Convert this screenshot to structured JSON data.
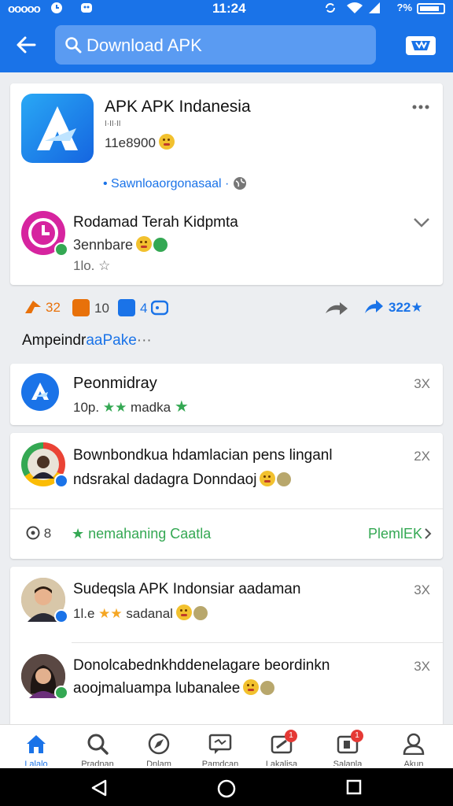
{
  "status_bar": {
    "dots": "ooooo",
    "time": "11:24",
    "battery_pct": "?%"
  },
  "search": {
    "placeholder": "Download APK"
  },
  "featured": {
    "app_title": "APK APK Indanesia",
    "app_subtitle": "I·II·II",
    "rating_text": "11e8900",
    "download_link": "Sawnloaorgonasaal ·",
    "sub_title": "Rodamad Terah Kidpmta",
    "sub_meta": "3ennbare",
    "sub_rating": "1lo. ☆"
  },
  "stats": {
    "items": [
      {
        "value": "32",
        "color": "#e8710a"
      },
      {
        "value": "10",
        "color": "#e8710a"
      },
      {
        "value": "4",
        "color": "#1a73e8"
      }
    ],
    "share_count": "322★"
  },
  "section": {
    "label_main": "Ampeindr",
    "label_accent": "aaPake",
    "label_tail": "···"
  },
  "list": [
    {
      "title": "Peonmidray",
      "meta_prefix": "10p.",
      "meta_stars": "★★",
      "meta_text": "madka",
      "meta_tail": "★",
      "count": "3X"
    },
    {
      "title": "Bownbondkua hdamlacian pens linganl",
      "line2": "ndsrakal dadagra Donndaoj",
      "count": "2X",
      "footer_left": "8",
      "footer_mid": "★ nemahaning Caatla",
      "footer_right": "PlemlEK"
    },
    {
      "title": "Sudeqsla APK  Indonsiar aadaman",
      "meta_prefix": "1l.e",
      "meta_stars": "★★",
      "meta_text": "sadanal",
      "count": "3X"
    },
    {
      "title": "Donolcabednkhddenelagare beordinkn",
      "line2": "aoojmaluampa lubanalee",
      "count": "3X"
    }
  ],
  "bottom_nav": [
    {
      "label": "Lalalo",
      "icon": "home-icon"
    },
    {
      "label": "Pradnan",
      "icon": "search-icon"
    },
    {
      "label": "Dnlam",
      "icon": "compass-icon"
    },
    {
      "label": "Pamdcan",
      "icon": "chat-icon"
    },
    {
      "label": "Lakalisa",
      "icon": "sale-icon",
      "badge": "1"
    },
    {
      "label": "Salanla",
      "icon": "wallet-icon",
      "badge": "1"
    },
    {
      "label": "Akun",
      "icon": "person-icon"
    }
  ],
  "colors": {
    "primary": "#1a73e8",
    "green": "#34a853",
    "orange": "#e8710a",
    "star": "#f5a623"
  }
}
